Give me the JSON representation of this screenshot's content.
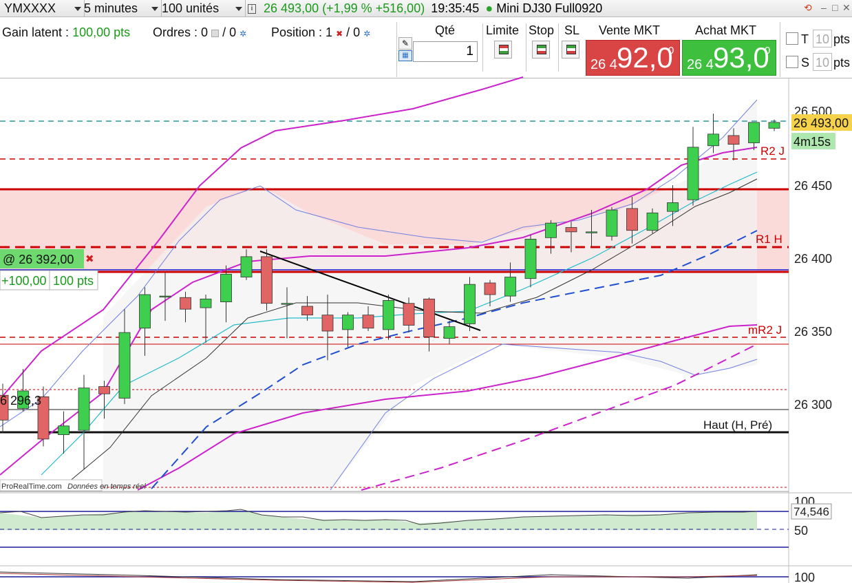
{
  "toolbar": {
    "instrument": "YMXXXX",
    "timeframe": "5 minutes",
    "units": "100 unités",
    "price_change": "26 493,00 (+1,99 % +516,00)",
    "time": "19:35:45",
    "contract": "Mini DJ30 Full0920"
  },
  "panel": {
    "gain_label": "Gain latent :",
    "gain_value": "100,00 pts",
    "orders_label": "Ordres : 0",
    "orders_suffix": "/ 0",
    "position_label": "Position : 1",
    "position_suffix": "/ 0",
    "qty_header": "Qté",
    "qty_value": "1",
    "limit_header": "Limite",
    "stop_header": "Stop",
    "sl_header": "SL",
    "sell_header": "Vente MKT",
    "buy_header": "Achat MKT",
    "sell_small": "26 4",
    "sell_big": "92,0",
    "sell_sup": "0",
    "buy_small": "26 4",
    "buy_big": "93,0",
    "buy_sup": "0",
    "t_label": "T",
    "t_value": "10",
    "t_unit": "pts",
    "s_label": "S",
    "s_value": "10",
    "s_unit": "pts"
  },
  "chart": {
    "y_ticks": [
      "26 500",
      "26 450",
      "26 400",
      "26 350",
      "26 300"
    ],
    "current_price": "26 493,00",
    "countdown": "4m15s",
    "levels": {
      "r2j": "R2 J",
      "r1h": "R1 H",
      "mr2j": "mR2 J",
      "haut": "Haut (H, Pré)"
    },
    "position_tag": "@ 26 392,00",
    "position_pnl": "+100,00",
    "position_pts": "100 pts",
    "left_value": "6 296,3",
    "attribution": "ProRealTime.com",
    "attribution_note": "Données en temps réel"
  },
  "indicators": {
    "osc_top": "100",
    "osc_value": "74,546",
    "osc_mid": "50",
    "second_top": "100"
  },
  "colors": {
    "bull": "#3fcf4f",
    "bear": "#e26565",
    "resistance_zone": "#fbdada",
    "accent_green": "#1a9a1a",
    "level_red": "#cc0000"
  },
  "candles": [
    {
      "o": 26306,
      "h": 26314,
      "l": 26280,
      "c": 26289
    },
    {
      "o": 26297,
      "h": 26324,
      "l": 26295,
      "c": 26309
    },
    {
      "o": 26305,
      "h": 26312,
      "l": 26271,
      "c": 26276
    },
    {
      "o": 26279,
      "h": 26295,
      "l": 26266,
      "c": 26285
    },
    {
      "o": 26282,
      "h": 26320,
      "l": 26255,
      "c": 26311
    },
    {
      "o": 26312,
      "h": 26316,
      "l": 26290,
      "c": 26307
    },
    {
      "o": 26304,
      "h": 26365,
      "l": 26300,
      "c": 26349
    },
    {
      "o": 26352,
      "h": 26380,
      "l": 26333,
      "c": 26375
    },
    {
      "o": 26374,
      "h": 26390,
      "l": 26357,
      "c": 26374
    },
    {
      "o": 26373,
      "h": 26377,
      "l": 26356,
      "c": 26365
    },
    {
      "o": 26366,
      "h": 26375,
      "l": 26342,
      "c": 26372
    },
    {
      "o": 26370,
      "h": 26395,
      "l": 26356,
      "c": 26389
    },
    {
      "o": 26387,
      "h": 26406,
      "l": 26385,
      "c": 26401
    },
    {
      "o": 26401,
      "h": 26406,
      "l": 26364,
      "c": 26369
    },
    {
      "o": 26369,
      "h": 26380,
      "l": 26345,
      "c": 26369
    },
    {
      "o": 26367,
      "h": 26374,
      "l": 26357,
      "c": 26361
    },
    {
      "o": 26361,
      "h": 26375,
      "l": 26330,
      "c": 26350
    },
    {
      "o": 26351,
      "h": 26363,
      "l": 26339,
      "c": 26361
    },
    {
      "o": 26361,
      "h": 26367,
      "l": 26350,
      "c": 26352
    },
    {
      "o": 26351,
      "h": 26375,
      "l": 26344,
      "c": 26371
    },
    {
      "o": 26369,
      "h": 26373,
      "l": 26349,
      "c": 26354
    },
    {
      "o": 26372,
      "h": 26373,
      "l": 26336,
      "c": 26346
    },
    {
      "o": 26345,
      "h": 26357,
      "l": 26341,
      "c": 26353
    },
    {
      "o": 26355,
      "h": 26387,
      "l": 26350,
      "c": 26382
    },
    {
      "o": 26383,
      "h": 26385,
      "l": 26367,
      "c": 26375
    },
    {
      "o": 26374,
      "h": 26397,
      "l": 26370,
      "c": 26387
    },
    {
      "o": 26386,
      "h": 26416,
      "l": 26380,
      "c": 26413
    },
    {
      "o": 26414,
      "h": 26426,
      "l": 26403,
      "c": 26424
    },
    {
      "o": 26421,
      "h": 26425,
      "l": 26404,
      "c": 26418
    },
    {
      "o": 26418,
      "h": 26433,
      "l": 26408,
      "c": 26418
    },
    {
      "o": 26415,
      "h": 26435,
      "l": 26412,
      "c": 26433
    },
    {
      "o": 26434,
      "h": 26442,
      "l": 26410,
      "c": 26419
    },
    {
      "o": 26419,
      "h": 26434,
      "l": 26417,
      "c": 26431
    },
    {
      "o": 26432,
      "h": 26450,
      "l": 26422,
      "c": 26438
    },
    {
      "o": 26440,
      "h": 26490,
      "l": 26436,
      "c": 26476
    },
    {
      "o": 26477,
      "h": 26499,
      "l": 26472,
      "c": 26485
    },
    {
      "o": 26484,
      "h": 26489,
      "l": 26467,
      "c": 26478
    },
    {
      "o": 26479,
      "h": 26493,
      "l": 26474,
      "c": 26493
    },
    {
      "o": 26489,
      "h": 26495,
      "l": 26487,
      "c": 26493
    }
  ]
}
